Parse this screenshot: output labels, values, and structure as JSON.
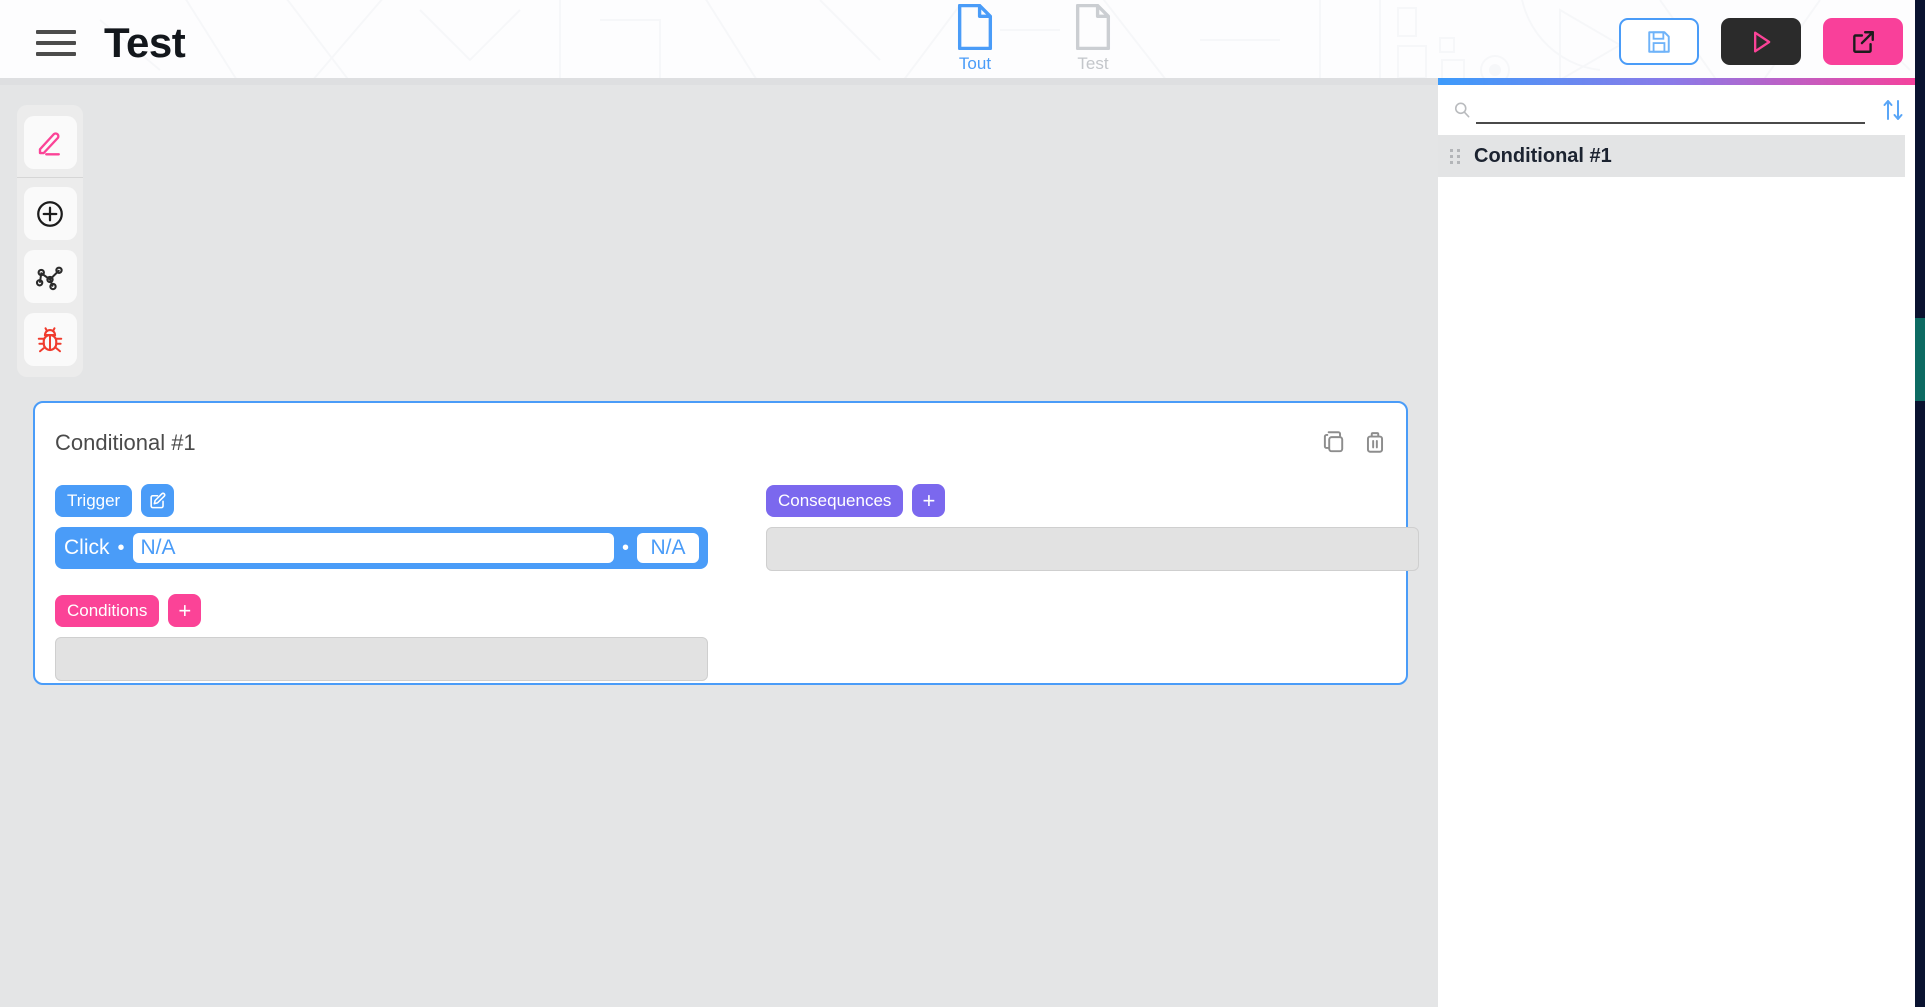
{
  "header": {
    "menu_icon": "hamburger-icon",
    "title": "Test",
    "tabs": [
      {
        "label": "Tout",
        "icon": "document-icon",
        "active": true
      },
      {
        "label": "Test",
        "icon": "document-icon",
        "active": false
      }
    ],
    "actions": [
      {
        "name": "save-button",
        "icon": "floppy-disk-icon",
        "style": "outline-blue"
      },
      {
        "name": "run-button",
        "icon": "play-triangle-icon",
        "style": "dark"
      },
      {
        "name": "open-external-button",
        "icon": "external-link-icon",
        "style": "pink"
      }
    ],
    "accent_gradient": [
      "#3d9bfb",
      "#8a7ae8",
      "#f9409a"
    ]
  },
  "toolbar": {
    "items": [
      {
        "name": "edit-tool",
        "icon": "pencil-icon",
        "color": "#fb4397"
      },
      {
        "name": "add-tool",
        "icon": "plus-circle-icon",
        "color": "#1c1c1c"
      },
      {
        "name": "graph-tool",
        "icon": "node-graph-icon",
        "color": "#2b2b2b"
      },
      {
        "name": "debug-tool",
        "icon": "bug-icon",
        "color": "#f03c2e"
      }
    ]
  },
  "card": {
    "title": "Conditional #1",
    "actions": [
      {
        "name": "duplicate-button",
        "icon": "copy-icon"
      },
      {
        "name": "delete-button",
        "icon": "trash-icon"
      }
    ],
    "trigger": {
      "badge_label": "Trigger",
      "edit_icon": "edit-square-icon",
      "event_label": "Click",
      "separator": "•",
      "target_value": "N/A",
      "param_value": "N/A"
    },
    "consequences": {
      "badge_label": "Consequences",
      "add_label": "+",
      "items": []
    },
    "conditions": {
      "badge_label": "Conditions",
      "add_label": "+",
      "items": []
    },
    "colors": {
      "trigger": "#4a9cf8",
      "consequences": "#7b68ee",
      "conditions": "#fb4397",
      "border": "#4a9cf8"
    }
  },
  "right_panel": {
    "search": {
      "value": "",
      "placeholder": "",
      "icon": "search-icon"
    },
    "sort_icon": "sort-arrows-icon",
    "list": [
      {
        "label": "Conditional #1",
        "handle_icon": "drag-handle-icon",
        "selected": true
      }
    ]
  }
}
